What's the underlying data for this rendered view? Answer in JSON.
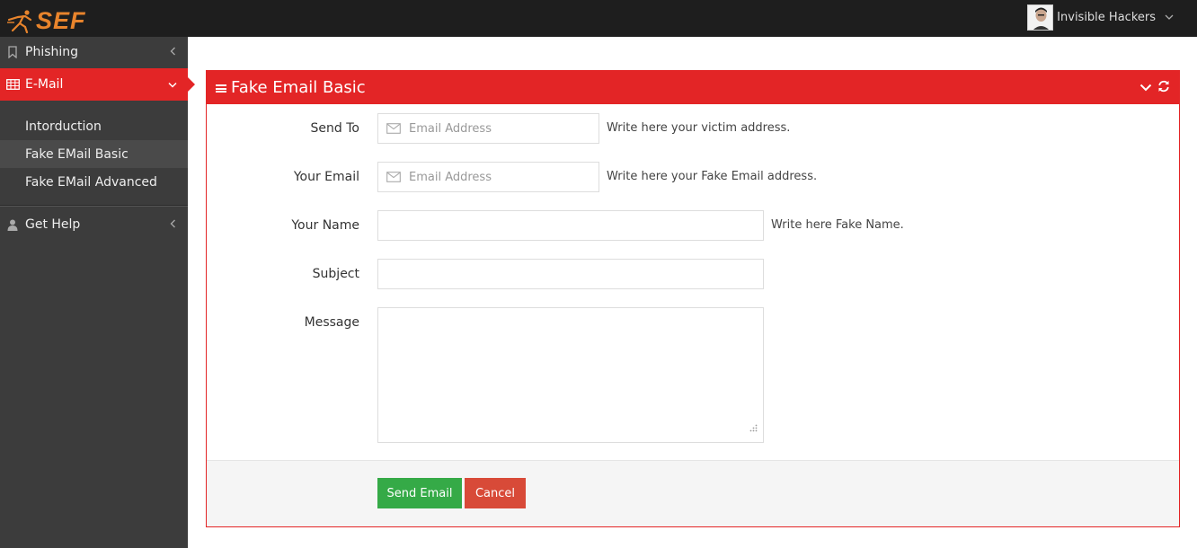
{
  "app": {
    "logo_text": "SEF"
  },
  "user": {
    "name": "Invisible Hackers"
  },
  "sidebar": {
    "items": [
      {
        "label": "Phishing"
      },
      {
        "label": "E-Mail"
      },
      {
        "label": "Get Help"
      }
    ],
    "submenu": [
      {
        "label": "Intorduction"
      },
      {
        "label": "Fake EMail Basic"
      },
      {
        "label": "Fake EMail Advanced"
      }
    ]
  },
  "panel": {
    "title": "Fake Email Basic",
    "fields": {
      "send_to": {
        "label": "Send To",
        "placeholder": "Email Address",
        "help": "Write here your victim address."
      },
      "your_email": {
        "label": "Your Email",
        "placeholder": "Email Address",
        "help": "Write here your Fake Email address."
      },
      "your_name": {
        "label": "Your Name",
        "help": "Write here Fake Name."
      },
      "subject": {
        "label": "Subject"
      },
      "message": {
        "label": "Message"
      }
    },
    "buttons": {
      "send": "Send Email",
      "cancel": "Cancel"
    }
  },
  "colors": {
    "accent": "#e32526",
    "send": "#35aa47",
    "cancel": "#d84a38",
    "logo": "#e8842c"
  }
}
